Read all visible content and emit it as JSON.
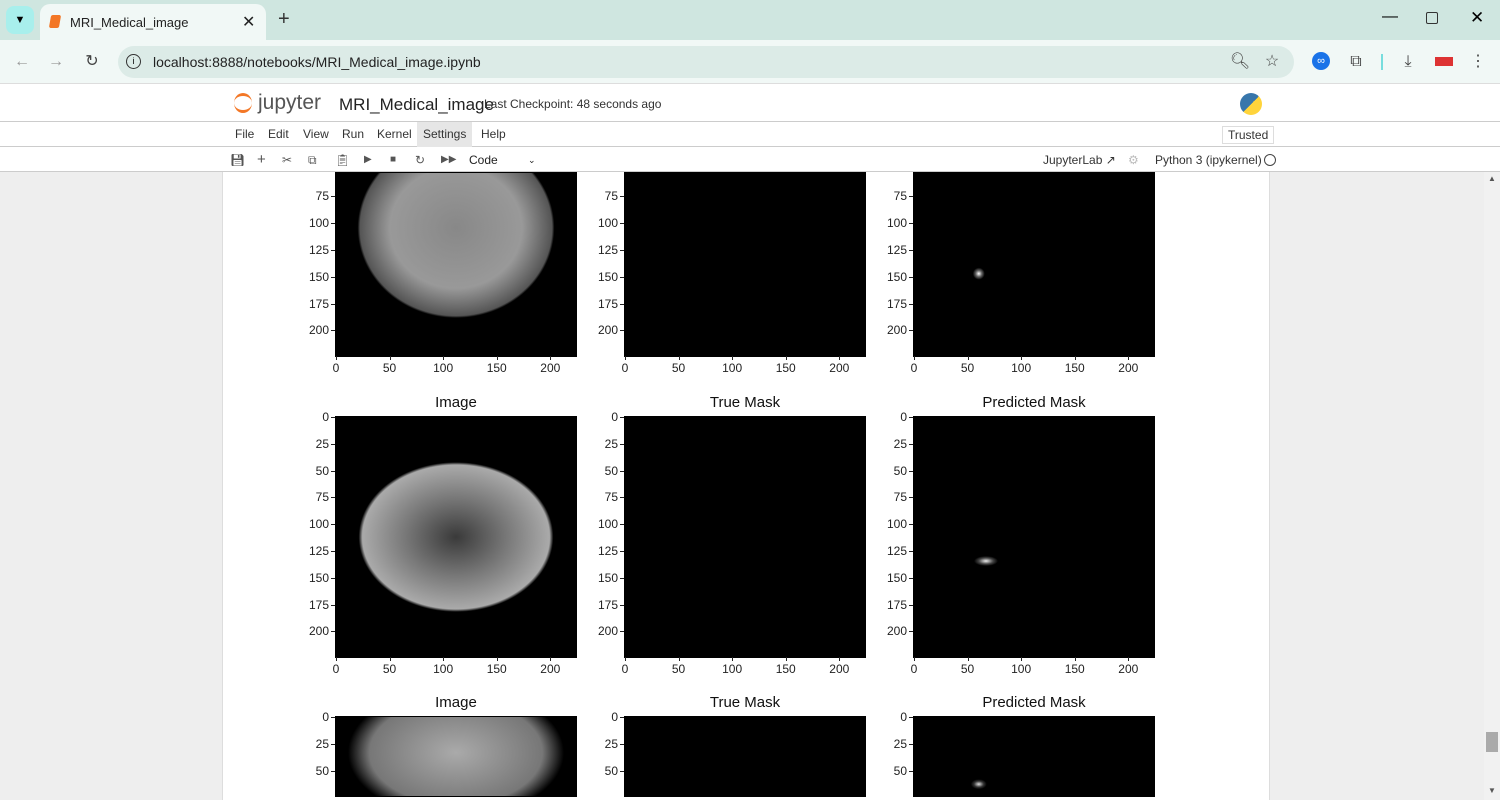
{
  "browser": {
    "tab_title": "MRI_Medical_image",
    "url": "localhost:8888/notebooks/MRI_Medical_image.ipynb"
  },
  "jupyter": {
    "logo_text": "jupyter",
    "notebook_name": "MRI_Medical_image",
    "checkpoint": "Last Checkpoint: 48 seconds ago",
    "trusted": "Trusted",
    "menu": [
      "File",
      "Edit",
      "View",
      "Run",
      "Kernel",
      "Settings",
      "Help"
    ],
    "cell_type": "Code",
    "jupyterlab": "JupyterLab",
    "kernel": "Python 3 (ipykernel)"
  },
  "figure": {
    "titles": [
      "Image",
      "True Mask",
      "Predicted Mask"
    ],
    "x_ticks": [
      "0",
      "50",
      "100",
      "150",
      "200"
    ],
    "y_ticks": [
      "0",
      "25",
      "50",
      "75",
      "100",
      "125",
      "150",
      "175",
      "200"
    ],
    "rows": 3,
    "row1_titles_visible": false
  }
}
